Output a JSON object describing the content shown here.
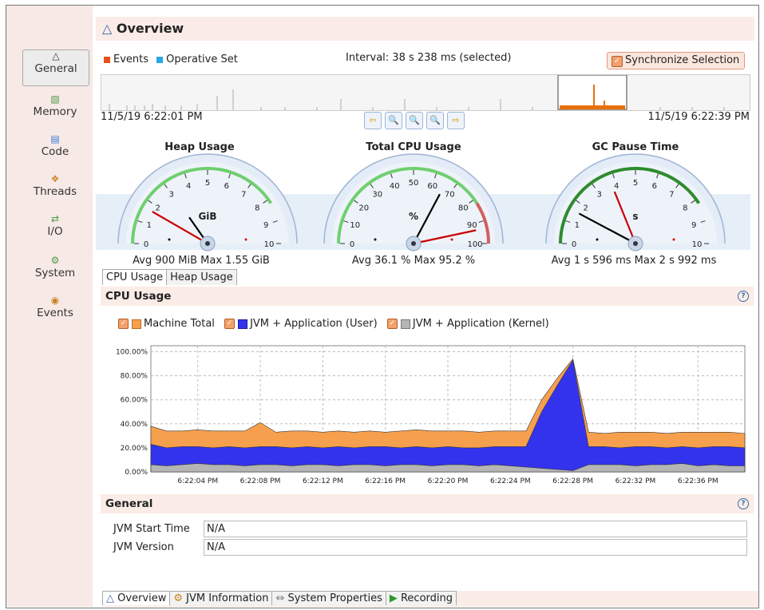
{
  "nav": [
    {
      "label": "General",
      "icon": "overview-icon",
      "active": true
    },
    {
      "label": "Memory",
      "icon": "memory-icon"
    },
    {
      "label": "Code",
      "icon": "code-icon"
    },
    {
      "label": "Threads",
      "icon": "threads-icon"
    },
    {
      "label": "I/O",
      "icon": "io-icon"
    },
    {
      "label": "System",
      "icon": "system-icon"
    },
    {
      "label": "Events",
      "icon": "events-icon"
    }
  ],
  "page": {
    "title": "Overview"
  },
  "toolbar": {
    "events_label": "Events",
    "operative_label": "Operative Set",
    "interval": "Interval: 38 s 238 ms (selected)",
    "sync_label": "Synchronize Selection",
    "date_start": "11/5/19 6:22:01 PM",
    "date_end": "11/5/19 6:22:39 PM"
  },
  "gauges": [
    {
      "title": "Heap Usage",
      "unit": "GiB",
      "ticks": [
        "0",
        "1",
        "2",
        "3",
        "4",
        "5",
        "6",
        "7",
        "8",
        "9",
        "10"
      ],
      "stat": "Avg 900 MiB   Max 1.55 GiB"
    },
    {
      "title": "Total CPU Usage",
      "unit": "%",
      "ticks": [
        "0",
        "10",
        "20",
        "30",
        "40",
        "50",
        "60",
        "70",
        "80",
        "90",
        "100"
      ],
      "stat": "Avg 36.1 %   Max 95.2 %"
    },
    {
      "title": "GC Pause Time",
      "unit": "s",
      "ticks": [
        "0",
        "1",
        "2",
        "3",
        "4",
        "5",
        "6",
        "7",
        "8",
        "9",
        "10"
      ],
      "stat": "Avg 1 s 596 ms   Max 2 s 992 ms"
    }
  ],
  "tabs": [
    "CPU Usage",
    "Heap Usage"
  ],
  "cpu_panel": {
    "title": "CPU Usage",
    "legend": [
      "Machine Total",
      "JVM + Application (User)",
      "JVM + Application (Kernel)"
    ]
  },
  "chart_data": {
    "type": "area",
    "x": [
      "6:22:01 PM",
      "6:22:02 PM",
      "6:22:03 PM",
      "6:22:04 PM",
      "6:22:05 PM",
      "6:22:06 PM",
      "6:22:07 PM",
      "6:22:08 PM",
      "6:22:09 PM",
      "6:22:10 PM",
      "6:22:11 PM",
      "6:22:12 PM",
      "6:22:13 PM",
      "6:22:14 PM",
      "6:22:15 PM",
      "6:22:16 PM",
      "6:22:17 PM",
      "6:22:18 PM",
      "6:22:19 PM",
      "6:22:20 PM",
      "6:22:21 PM",
      "6:22:22 PM",
      "6:22:23 PM",
      "6:22:24 PM",
      "6:22:25 PM",
      "6:22:26 PM",
      "6:22:27 PM",
      "6:22:28 PM",
      "6:22:29 PM",
      "6:22:30 PM",
      "6:22:31 PM",
      "6:22:32 PM",
      "6:22:33 PM",
      "6:22:34 PM",
      "6:22:35 PM",
      "6:22:36 PM",
      "6:22:37 PM",
      "6:22:38 PM",
      "6:22:39 PM"
    ],
    "xticks": [
      "6:22:04 PM",
      "6:22:08 PM",
      "6:22:12 PM",
      "6:22:16 PM",
      "6:22:20 PM",
      "6:22:24 PM",
      "6:22:28 PM",
      "6:22:32 PM",
      "6:22:36 PM"
    ],
    "yticks": [
      "0.00%",
      "20.00%",
      "40.00%",
      "60.00%",
      "80.00%",
      "100.00%"
    ],
    "ylim": [
      0,
      105
    ],
    "series": [
      {
        "name": "Machine Total",
        "color": "#f6a04d",
        "values": [
          38,
          34,
          34,
          35,
          34,
          34,
          34,
          41,
          33,
          34,
          34,
          33,
          34,
          33,
          34,
          33,
          34,
          35,
          34,
          34,
          34,
          33,
          34,
          34,
          34,
          60,
          78,
          94,
          33,
          32,
          33,
          33,
          33,
          32,
          33,
          33,
          33,
          33,
          32
        ]
      },
      {
        "name": "JVM + Application (User)",
        "color": "#3333ee",
        "values": [
          23,
          20,
          21,
          21,
          20,
          21,
          20,
          21,
          21,
          20,
          21,
          20,
          21,
          20,
          21,
          21,
          20,
          21,
          20,
          21,
          20,
          20,
          21,
          21,
          21,
          50,
          72,
          93,
          21,
          21,
          20,
          21,
          21,
          20,
          21,
          20,
          21,
          21,
          20
        ]
      },
      {
        "name": "JVM + Application (Kernel)",
        "color": "#b5b5b5",
        "values": [
          6,
          5,
          6,
          7,
          6,
          6,
          5,
          6,
          6,
          5,
          6,
          6,
          5,
          6,
          6,
          5,
          6,
          6,
          5,
          6,
          6,
          5,
          6,
          5,
          4,
          3,
          2,
          1,
          6,
          6,
          6,
          5,
          6,
          6,
          7,
          5,
          6,
          5,
          5
        ]
      }
    ]
  },
  "general": {
    "title": "General",
    "fields": [
      {
        "label": "JVM Start Time",
        "value": "N/A"
      },
      {
        "label": "JVM Version",
        "value": "N/A"
      }
    ]
  },
  "bottom_tabs": [
    {
      "label": "Overview",
      "icon": "overview-icon",
      "active": true
    },
    {
      "label": "JVM Information",
      "icon": "jvm-info-icon"
    },
    {
      "label": "System Properties",
      "icon": "properties-icon"
    },
    {
      "label": "Recording",
      "icon": "recording-icon"
    }
  ],
  "colors": {
    "accent": "#f7e9e5",
    "events": "#e8501c",
    "operative": "#2aa7e8"
  }
}
